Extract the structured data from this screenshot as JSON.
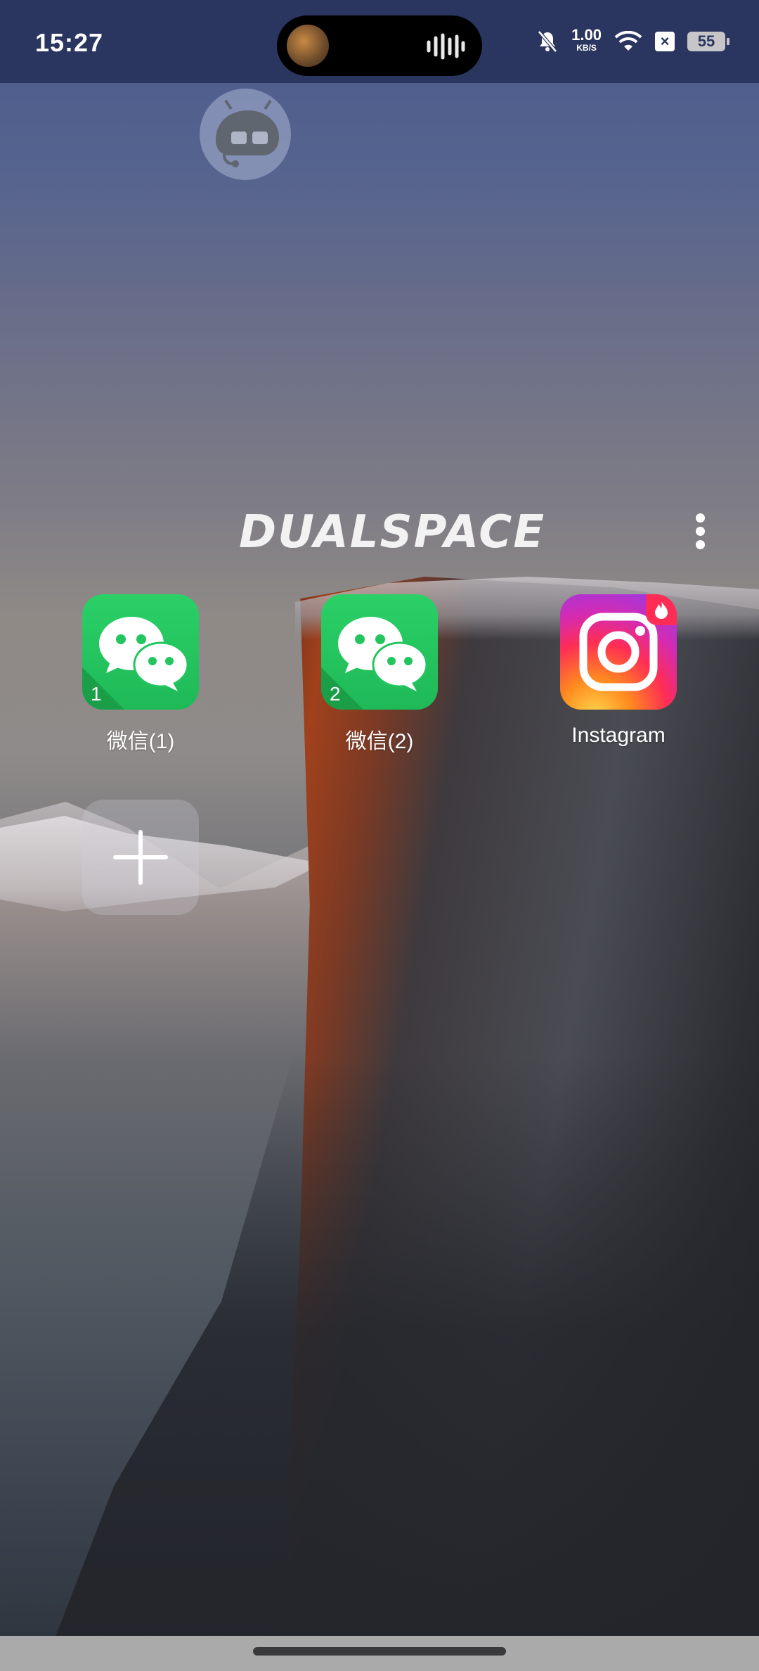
{
  "status_bar": {
    "time": "15:27",
    "net_speed": "1.00",
    "net_unit": "KB/S",
    "battery": "55",
    "icons": [
      "mute-bell-icon",
      "wifi-icon",
      "close-box-icon",
      "battery-icon",
      "audio-wave-icon"
    ]
  },
  "header": {
    "logo_text": "DUALSPACE",
    "menu_icon": "more-vertical-icon"
  },
  "apps": [
    {
      "label": "微信(1)",
      "badge": "1",
      "icon": "wechat-icon"
    },
    {
      "label": "微信(2)",
      "badge": "2",
      "icon": "wechat-icon"
    },
    {
      "label": "Instagram",
      "badge": "",
      "icon": "instagram-icon"
    }
  ],
  "add_app": {
    "icon": "plus-icon"
  },
  "colors": {
    "status_bar": "#2b3660",
    "wechat_green": "#22c55e",
    "instagram_pink": "#ff2d55"
  }
}
